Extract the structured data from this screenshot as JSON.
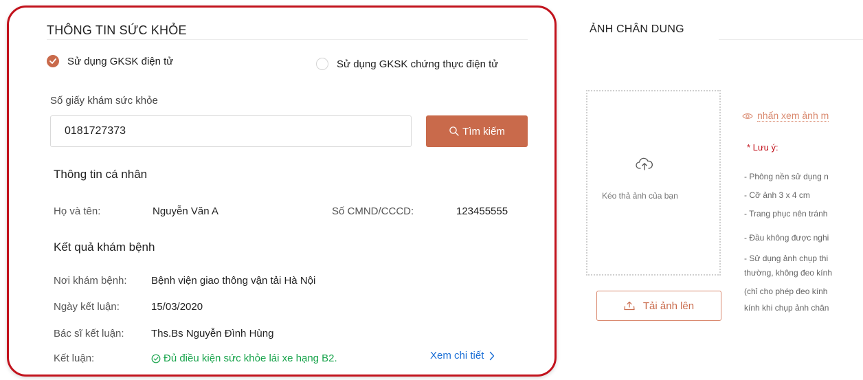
{
  "health": {
    "title": "THÔNG TIN SỨC KHỎE",
    "option_electronic": "Sử dụng GKSK điện tử",
    "option_certified": "Sử dụng GKSK chứng thực điện tử",
    "cert_number_label": "Số giấy khám sức khỏe",
    "cert_number_value": "0181727373",
    "search_label": "Tìm kiếm",
    "personal_title": "Thông tin cá nhân",
    "name_label": "Họ và tên:",
    "name_value": "Nguyễn Văn A",
    "id_label": "Số CMND/CCCD:",
    "id_value": "123455555",
    "result_title": "Kết quả khám bệnh",
    "place_label": "Nơi khám bệnh:",
    "place_value": "Bệnh viện giao thông vận tải Hà Nội",
    "date_label": "Ngày kết luận:",
    "date_value": "15/03/2020",
    "doctor_label": "Bác sĩ kết luận:",
    "doctor_value": "Ths.Bs Nguyễn Đình Hùng",
    "conclusion_label": "Kết luận:",
    "conclusion_value": "Đủ điều kiện sức khỏe lái xe hạng B2.",
    "detail_link": "Xem chi tiết"
  },
  "portrait": {
    "title": "ẢNH CHÂN DUNG",
    "drop_hint": "Kéo thả ảnh của bạn",
    "upload_label": "Tải ảnh lên",
    "preview_link": "nhấn xem ảnh m",
    "note_title": "* Lưu ý:",
    "notes": [
      "- Phông nền sử dụng n",
      "- Cỡ ảnh 3 x 4 cm",
      "- Trang phục nên tránh",
      "- Đầu không được nghi",
      "- Sử dụng ảnh chụp thi",
      "thường, không đeo kính",
      "(chỉ cho phép đeo kính",
      "kính khi chụp ảnh chân"
    ]
  },
  "colors": {
    "accent": "#c96a4b",
    "card_border": "#c2121c",
    "success": "#16a34a",
    "link": "#1b6fd6"
  }
}
